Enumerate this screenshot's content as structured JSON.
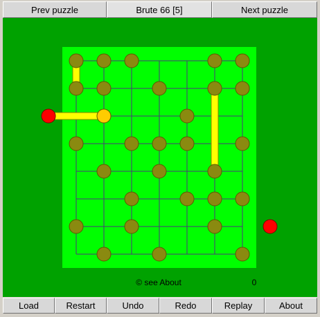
{
  "header": {
    "prev_label": "Prev puzzle",
    "title": "Brute 66  [5]",
    "next_label": "Next puzzle"
  },
  "footer": {
    "copyright": "© see About",
    "move_count": "0"
  },
  "toolbar": {
    "buttons": [
      {
        "name": "load-button",
        "label": "Load"
      },
      {
        "name": "restart-button",
        "label": "Restart"
      },
      {
        "name": "undo-button",
        "label": "Undo"
      },
      {
        "name": "redo-button",
        "label": "Redo"
      },
      {
        "name": "replay-button",
        "label": "Replay"
      },
      {
        "name": "about-button",
        "label": "About"
      }
    ]
  },
  "colors": {
    "outer_green": "#00a200",
    "board_green": "#00ff00",
    "grid_line": "#4a3a7a",
    "peg": "#8a8a10",
    "peg_outline": "#5a5a00",
    "bar": "#ffff00",
    "bar_outline": "#8a8a00",
    "selected_peg": "#ffcc00",
    "endpoint": "#ff0000"
  },
  "board": {
    "columns": 7,
    "rows": 8,
    "pegs": [
      {
        "col": 0,
        "row": 0
      },
      {
        "col": 1,
        "row": 0
      },
      {
        "col": 2,
        "row": 0
      },
      {
        "col": 5,
        "row": 0
      },
      {
        "col": 6,
        "row": 0
      },
      {
        "col": 0,
        "row": 1
      },
      {
        "col": 1,
        "row": 1
      },
      {
        "col": 3,
        "row": 1
      },
      {
        "col": 5,
        "row": 1
      },
      {
        "col": 6,
        "row": 1
      },
      {
        "col": 1,
        "row": 2,
        "state": "selected"
      },
      {
        "col": 4,
        "row": 2
      },
      {
        "col": 0,
        "row": 3
      },
      {
        "col": 2,
        "row": 3
      },
      {
        "col": 3,
        "row": 3
      },
      {
        "col": 4,
        "row": 3
      },
      {
        "col": 6,
        "row": 3
      },
      {
        "col": 1,
        "row": 4
      },
      {
        "col": 3,
        "row": 4
      },
      {
        "col": 5,
        "row": 4
      },
      {
        "col": 2,
        "row": 5
      },
      {
        "col": 4,
        "row": 5
      },
      {
        "col": 5,
        "row": 5
      },
      {
        "col": 6,
        "row": 5
      },
      {
        "col": 0,
        "row": 6
      },
      {
        "col": 2,
        "row": 6
      },
      {
        "col": 5,
        "row": 6
      },
      {
        "col": 1,
        "row": 7
      },
      {
        "col": 3,
        "row": 7
      },
      {
        "col": 6,
        "row": 7
      }
    ],
    "endpoints": [
      {
        "col": -1,
        "row": 2
      },
      {
        "col": 7,
        "row": 6
      }
    ],
    "bars": [
      {
        "from": {
          "col": 0,
          "row": 0
        },
        "to": {
          "col": 0,
          "row": 1
        }
      },
      {
        "from": {
          "col": -1,
          "row": 2
        },
        "to": {
          "col": 1,
          "row": 2
        }
      },
      {
        "from": {
          "col": 5,
          "row": 1
        },
        "to": {
          "col": 5,
          "row": 4
        }
      }
    ]
  }
}
